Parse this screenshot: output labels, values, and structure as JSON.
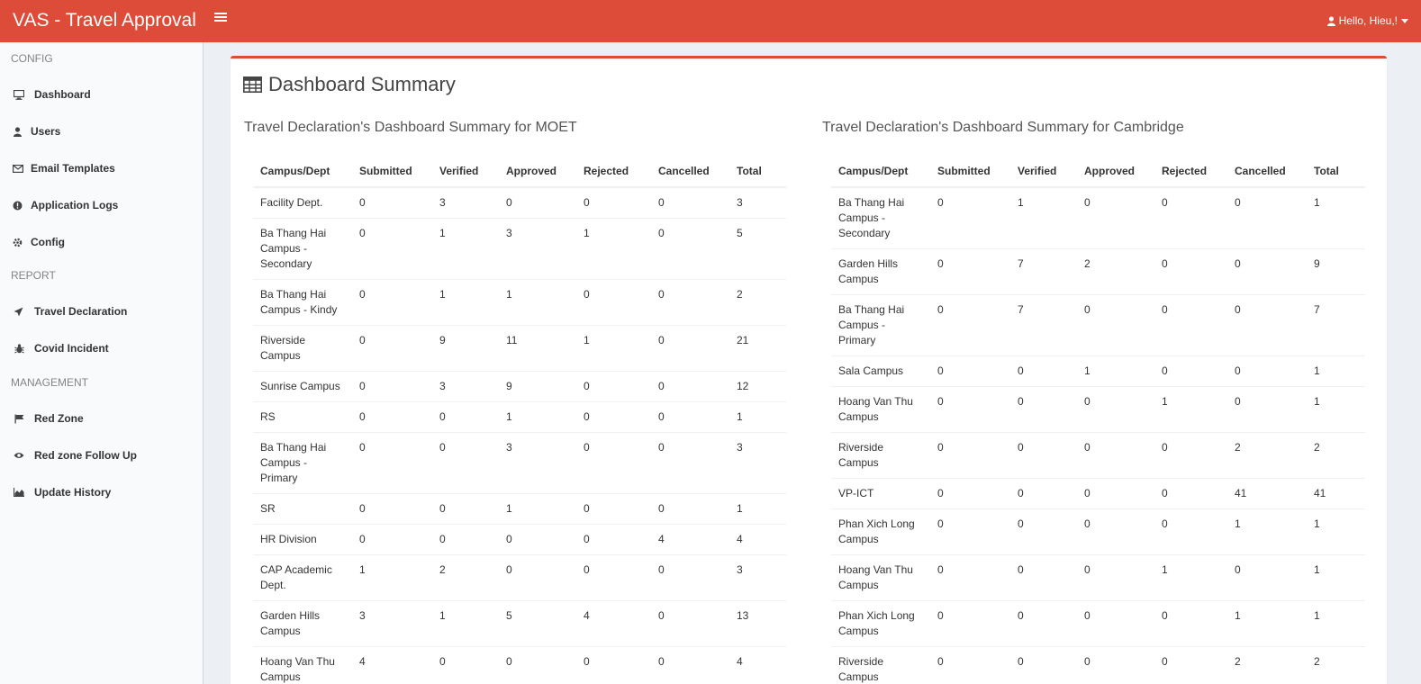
{
  "app": {
    "title": "VAS - Travel Approval",
    "user_greeting": "Hello, Hieu,!"
  },
  "colors": {
    "brand": "#dd4b39",
    "sidebar_bg": "#f9fafc",
    "page_bg": "#ecf0f5"
  },
  "sidebar": {
    "sections": [
      {
        "header": "CONFIG",
        "items": [
          {
            "label": "Dashboard",
            "icon": "desktop-icon"
          },
          {
            "label": "Users",
            "icon": "user-icon"
          },
          {
            "label": "Email Templates",
            "icon": "envelope-icon"
          },
          {
            "label": "Application Logs",
            "icon": "info-circle-icon"
          },
          {
            "label": "Config",
            "icon": "gear-icon"
          }
        ]
      },
      {
        "header": "REPORT",
        "items": [
          {
            "label": "Travel Declaration",
            "icon": "plane-icon"
          },
          {
            "label": "Covid Incident",
            "icon": "bug-icon"
          }
        ]
      },
      {
        "header": "MANAGEMENT",
        "items": [
          {
            "label": "Red Zone",
            "icon": "flag-icon"
          },
          {
            "label": "Red zone Follow Up",
            "icon": "eye-icon"
          },
          {
            "label": "Update History",
            "icon": "area-chart-icon"
          }
        ]
      }
    ]
  },
  "main": {
    "title": "Dashboard Summary",
    "tables": [
      {
        "title": "Travel Declaration's Dashboard Summary for MOET",
        "columns": [
          "Campus/Dept",
          "Submitted",
          "Verified",
          "Approved",
          "Rejected",
          "Cancelled",
          "Total"
        ],
        "rows": [
          [
            "Facility Dept.",
            "0",
            "3",
            "0",
            "0",
            "0",
            "3"
          ],
          [
            "Ba Thang Hai Campus - Secondary",
            "0",
            "1",
            "3",
            "1",
            "0",
            "5"
          ],
          [
            "Ba Thang Hai Campus - Kindy",
            "0",
            "1",
            "1",
            "0",
            "0",
            "2"
          ],
          [
            "Riverside Campus",
            "0",
            "9",
            "11",
            "1",
            "0",
            "21"
          ],
          [
            "Sunrise Campus",
            "0",
            "3",
            "9",
            "0",
            "0",
            "12"
          ],
          [
            "RS",
            "0",
            "0",
            "1",
            "0",
            "0",
            "1"
          ],
          [
            "Ba Thang Hai Campus - Primary",
            "0",
            "0",
            "3",
            "0",
            "0",
            "3"
          ],
          [
            "SR",
            "0",
            "0",
            "1",
            "0",
            "0",
            "1"
          ],
          [
            "HR Division",
            "0",
            "0",
            "0",
            "0",
            "4",
            "4"
          ],
          [
            "CAP Academic Dept.",
            "1",
            "2",
            "0",
            "0",
            "0",
            "3"
          ],
          [
            "Garden Hills Campus",
            "3",
            "1",
            "5",
            "4",
            "0",
            "13"
          ],
          [
            "Hoang Van Thu Campus",
            "4",
            "0",
            "0",
            "0",
            "0",
            "4"
          ]
        ]
      },
      {
        "title": "Travel Declaration's Dashboard Summary for Cambridge",
        "columns": [
          "Campus/Dept",
          "Submitted",
          "Verified",
          "Approved",
          "Rejected",
          "Cancelled",
          "Total"
        ],
        "rows": [
          [
            "Ba Thang Hai Campus - Secondary",
            "0",
            "1",
            "0",
            "0",
            "0",
            "1"
          ],
          [
            "Garden Hills Campus",
            "0",
            "7",
            "2",
            "0",
            "0",
            "9"
          ],
          [
            "Ba Thang Hai Campus - Primary",
            "0",
            "7",
            "0",
            "0",
            "0",
            "7"
          ],
          [
            "Sala Campus",
            "0",
            "0",
            "1",
            "0",
            "0",
            "1"
          ],
          [
            "Hoang Van Thu Campus",
            "0",
            "0",
            "0",
            "1",
            "0",
            "1"
          ],
          [
            "Riverside Campus",
            "0",
            "0",
            "0",
            "0",
            "2",
            "2"
          ],
          [
            "VP-ICT",
            "0",
            "0",
            "0",
            "0",
            "41",
            "41"
          ],
          [
            "Phan Xich Long Campus",
            "0",
            "0",
            "0",
            "0",
            "1",
            "1"
          ],
          [
            "Hoang Van Thu Campus",
            "0",
            "0",
            "0",
            "1",
            "0",
            "1"
          ],
          [
            "Phan Xich Long Campus",
            "0",
            "0",
            "0",
            "0",
            "1",
            "1"
          ],
          [
            "Riverside Campus",
            "0",
            "0",
            "0",
            "0",
            "2",
            "2"
          ]
        ]
      }
    ]
  }
}
